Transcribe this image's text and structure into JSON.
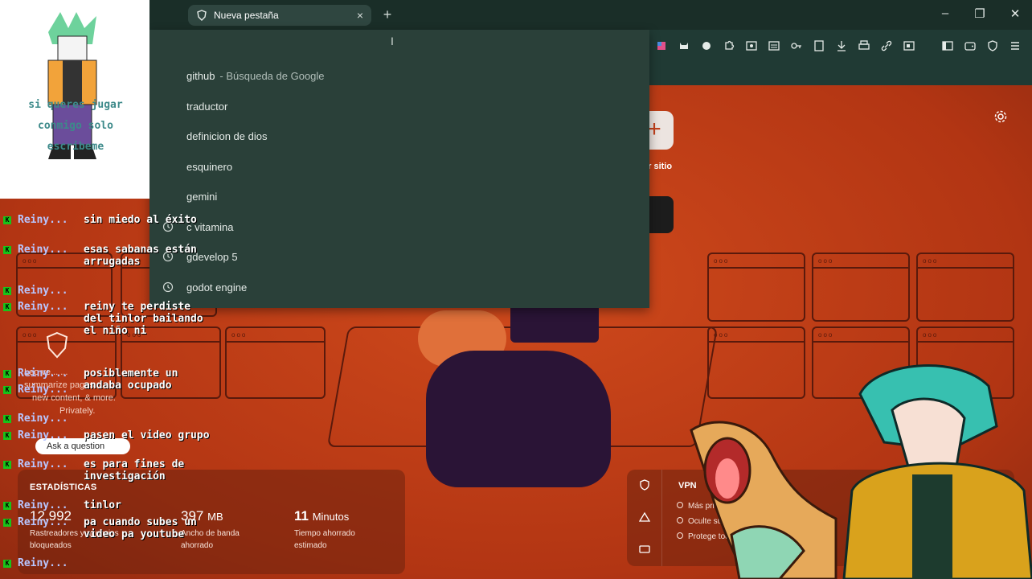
{
  "browser": {
    "tab_title": "Nueva pestaña",
    "tab_close": "×",
    "new_tab": "+",
    "window_controls": [
      "–",
      "❐",
      "✕"
    ]
  },
  "toolbar_icons": [
    "color-picker-icon",
    "cat-extension-icon",
    "cube-extension-icon",
    "puzzle-icon",
    "screenshot-icon",
    "reader-icon",
    "key-icon",
    "bookmark-icon",
    "download-icon",
    "print-icon",
    "link-icon",
    "media-icon",
    "sidebar-icon",
    "wallet-icon",
    "brave-shield-icon",
    "menu-icon"
  ],
  "omnibox": {
    "suggestions": [
      {
        "text": "github",
        "sub": "- Búsqueda de Google",
        "history": false
      },
      {
        "text": "traductor",
        "sub": "",
        "history": false
      },
      {
        "text": "definicion de dios",
        "sub": "",
        "history": false
      },
      {
        "text": "esquinero",
        "sub": "",
        "history": false
      },
      {
        "text": "gemini",
        "sub": "",
        "history": false
      },
      {
        "text": "c vitamina",
        "sub": "",
        "history": true
      },
      {
        "text": "gdevelop 5",
        "sub": "",
        "history": true
      },
      {
        "text": "godot engine",
        "sub": "",
        "history": true
      }
    ]
  },
  "ntp": {
    "add_site_label": "lir sitio",
    "add_site_symbol": "+"
  },
  "avatar_overlay": {
    "lines": [
      "si queres jugar",
      "conmigo solo",
      "escribeme"
    ]
  },
  "chat": {
    "users": [
      "Reiny...",
      "Reiny...",
      "Reiny...",
      "Reiny...",
      "Reiny...",
      "Reiny...",
      "Reiny...",
      "Reiny...",
      "Reiny...",
      "Reiny...",
      "Reiny...",
      "Reiny...",
      "Reiny..."
    ],
    "messages": [
      "sin miedo al éxito",
      "esas sabanas están arrugadas",
      "reiny te perdiste del tinlor bailando el niño ni",
      "posiblemente un andaba ocupado",
      "pasen el video grupo",
      "es para fines de investigación",
      "tinlor",
      "pa cuando subes un video pa youtube"
    ]
  },
  "leo": {
    "line1": "Leo ve... ...",
    "line2": "summarize pages, ...",
    "line3": "new content, & more.",
    "line4": "Privately.",
    "ask_label": "Ask a question"
  },
  "stats": {
    "heading": "ESTADÍSTICAS",
    "trackers_value": "12.992",
    "trackers_label": "Rastreadores y anuncios bloqueados",
    "bandwidth_value": "397",
    "bandwidth_unit": "MB",
    "bandwidth_label": "Ancho de banda ahorrado",
    "time_value": "11",
    "time_unit": "Minutos",
    "time_label": "Tiempo ahorrado estimado"
  },
  "vpn": {
    "title": "VPN",
    "rows": [
      "Más privacidad en línea",
      "Oculte su IP y cambie su ubicación",
      "Protege todas las conexiones"
    ]
  },
  "colors": {
    "chrome_dark": "#1a2e28",
    "omnibox_bg": "#2a4039",
    "ntp_orange": "#c2401a",
    "chat_badge": "#19c319"
  }
}
